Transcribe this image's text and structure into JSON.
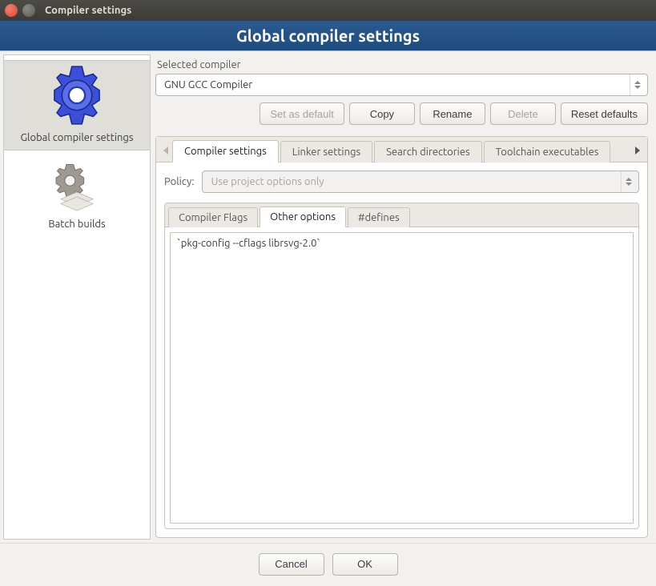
{
  "window": {
    "title": "Compiler settings"
  },
  "banner": {
    "title": "Global compiler settings"
  },
  "sidebar": {
    "items": [
      {
        "label": "Global compiler settings",
        "selected": true
      },
      {
        "label": "Batch builds",
        "selected": false
      }
    ]
  },
  "compiler_section": {
    "label": "Selected compiler",
    "selected": "GNU GCC Compiler",
    "buttons": {
      "set_default": "Set as default",
      "copy": "Copy",
      "rename": "Rename",
      "delete": "Delete",
      "reset": "Reset defaults"
    }
  },
  "tabs": {
    "items": [
      {
        "label": "Compiler settings",
        "active": true
      },
      {
        "label": "Linker settings",
        "active": false
      },
      {
        "label": "Search directories",
        "active": false
      },
      {
        "label": "Toolchain executables",
        "active": false
      }
    ]
  },
  "policy": {
    "label": "Policy:",
    "value": "Use project options only"
  },
  "subtabs": {
    "items": [
      {
        "label": "Compiler Flags",
        "active": false
      },
      {
        "label": "Other options",
        "active": true
      },
      {
        "label": "#defines",
        "active": false
      }
    ]
  },
  "other_options": {
    "text": "`pkg-config --cflags librsvg-2.0`"
  },
  "footer": {
    "cancel": "Cancel",
    "ok": "OK"
  }
}
